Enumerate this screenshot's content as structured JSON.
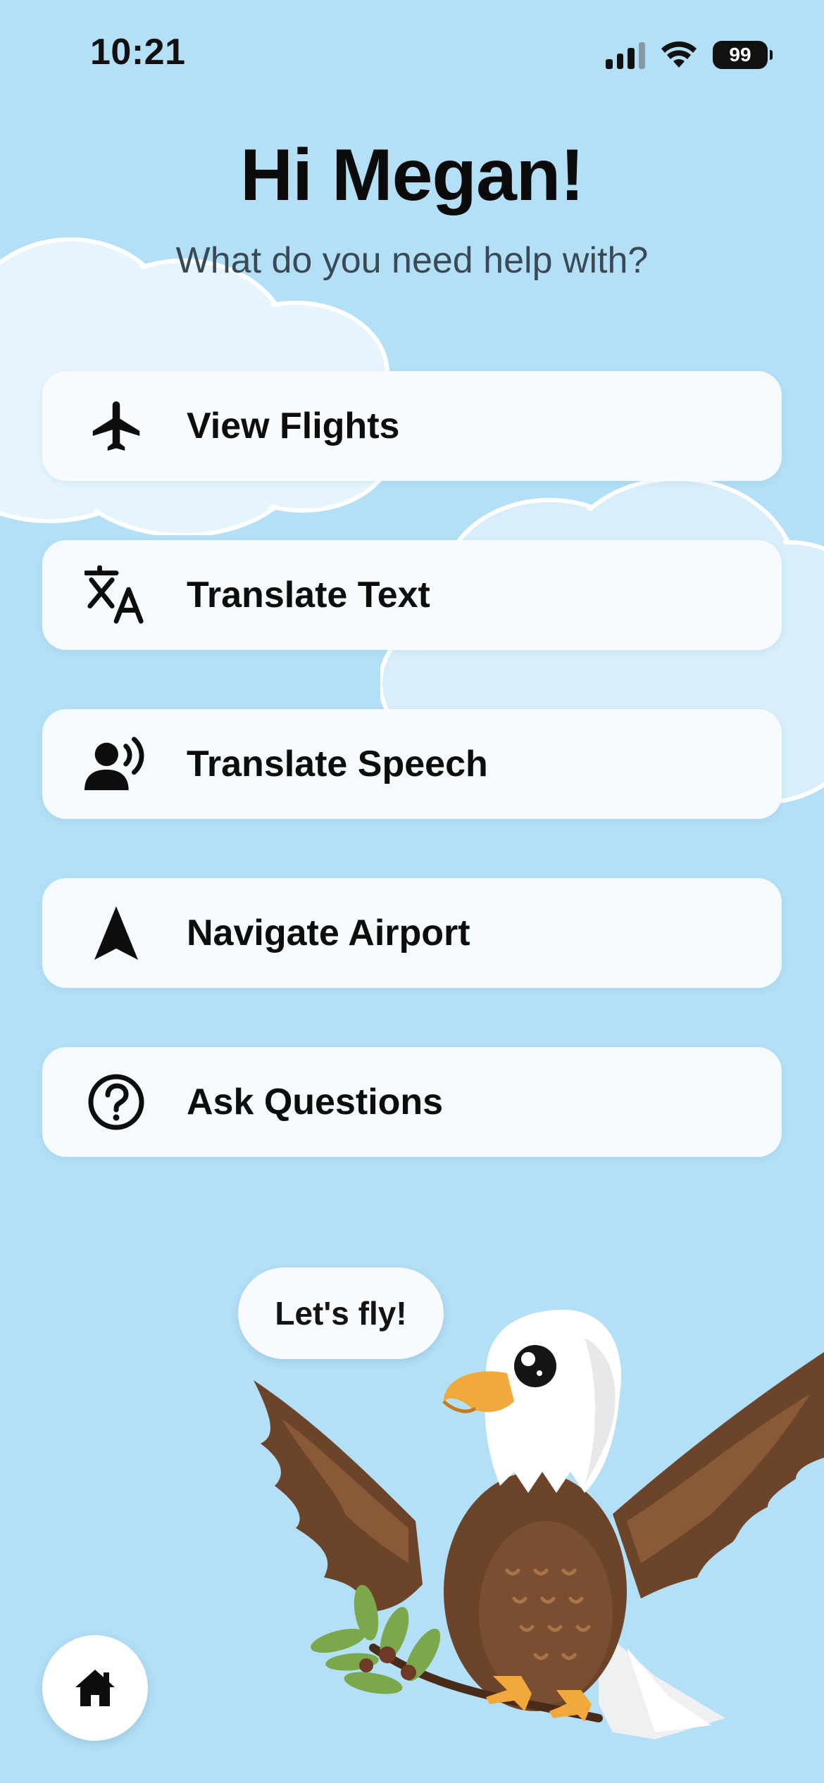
{
  "status_bar": {
    "time": "10:21",
    "battery": "99",
    "icons": [
      "cellular-signal-icon",
      "wifi-icon",
      "battery-icon"
    ]
  },
  "header": {
    "greeting": "Hi Megan!",
    "subtitle": "What do you need help with?"
  },
  "menu": {
    "items": [
      {
        "label": "View Flights",
        "icon": "airplane-icon"
      },
      {
        "label": "Translate Text",
        "icon": "translate-icon"
      },
      {
        "label": "Translate Speech",
        "icon": "speaking-person-icon"
      },
      {
        "label": "Navigate Airport",
        "icon": "navigation-arrow-icon"
      },
      {
        "label": "Ask Questions",
        "icon": "question-circle-icon"
      }
    ]
  },
  "mascot": {
    "speech": "Let's fly!",
    "image": "bald-eagle-mascot"
  },
  "bottom_bar": {
    "home_icon": "home-icon"
  },
  "colors": {
    "background": "#b3e0f7",
    "button_background": "#f8fbfd",
    "text": "#0d0d0d",
    "subtitle": "#3a4a55",
    "eagle_brown": "#6b4429",
    "eagle_beak": "#f2a93b"
  }
}
